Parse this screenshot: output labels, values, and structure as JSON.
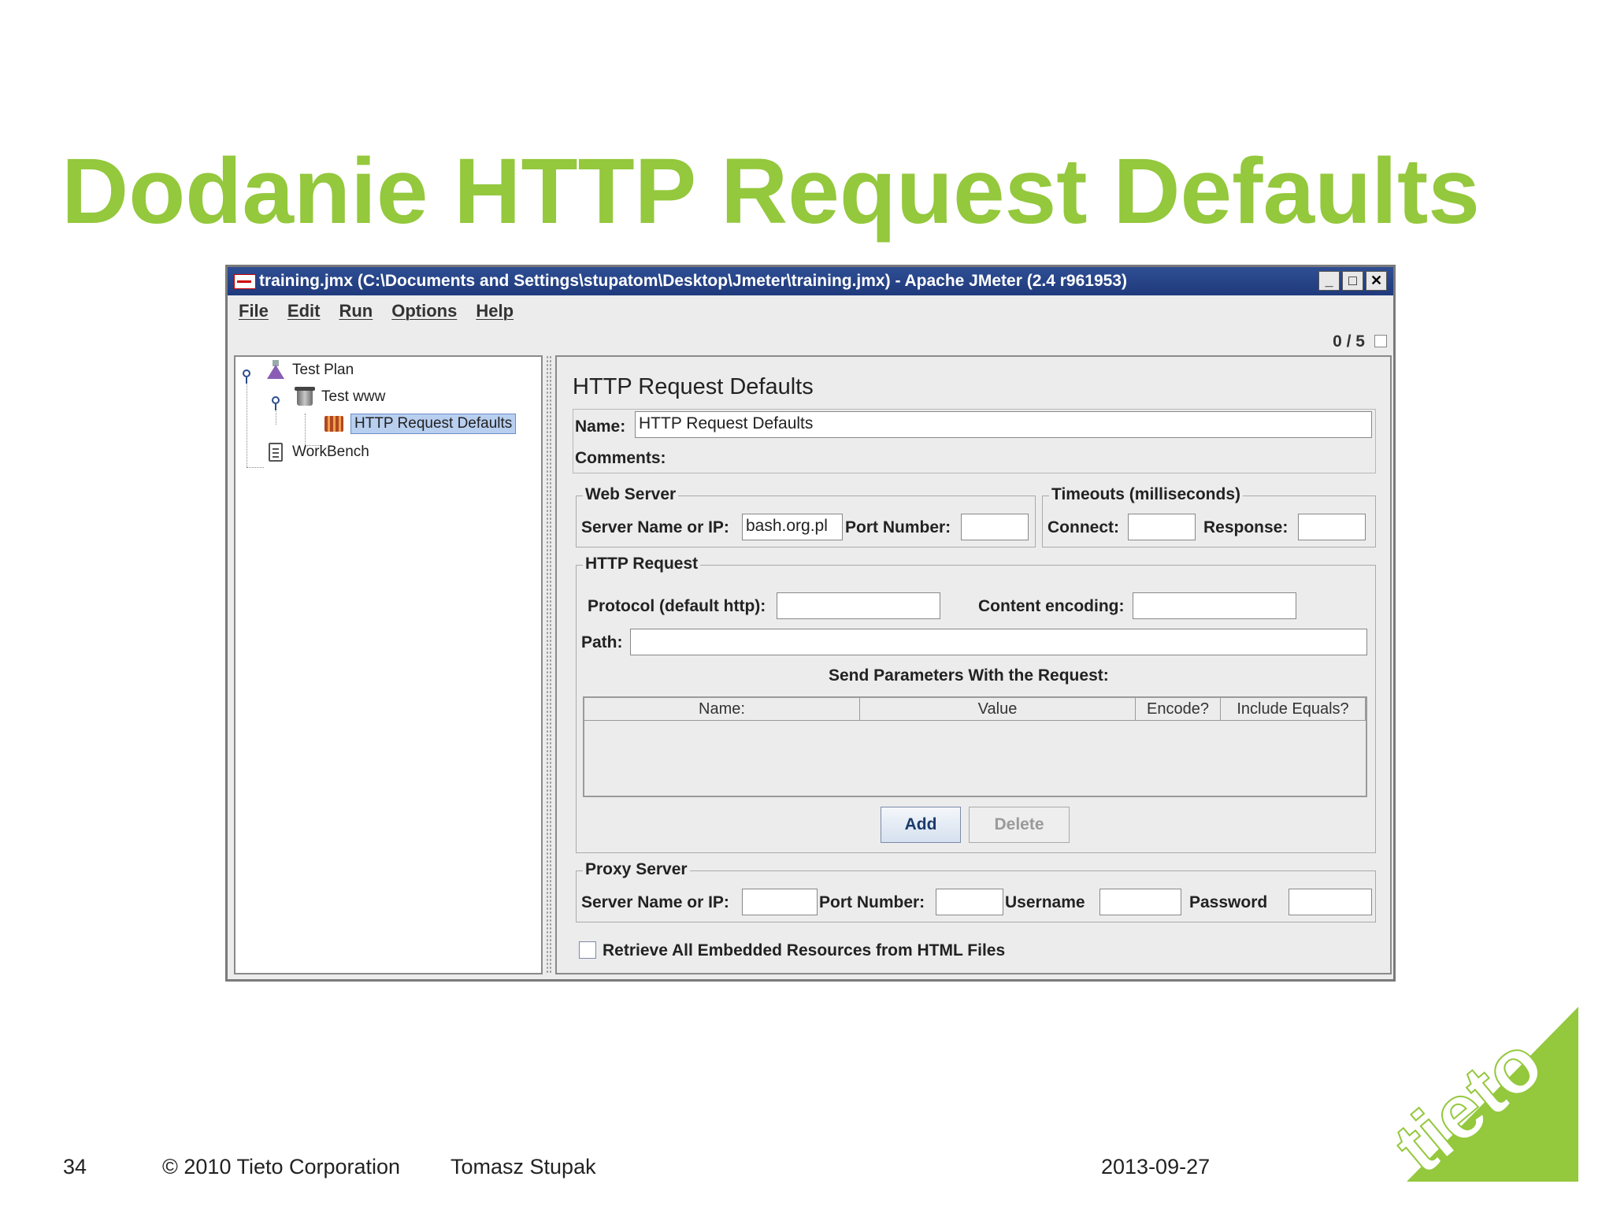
{
  "slide": {
    "title": "Dodanie HTTP Request Defaults"
  },
  "window": {
    "title": "training.jmx (C:\\Documents and Settings\\stupatom\\Desktop\\Jmeter\\training.jmx) - Apache JMeter (2.4 r961953)",
    "controls": {
      "minimize": "_",
      "maximize": "□",
      "close": "✕"
    },
    "menu": [
      "File",
      "Edit",
      "Run",
      "Options",
      "Help"
    ],
    "thread_counter": "0 / 5"
  },
  "tree": {
    "nodes": [
      {
        "label": "Test Plan",
        "icon": "flask-icon"
      },
      {
        "label": "Test www",
        "icon": "thread-group-icon"
      },
      {
        "label": "HTTP Request Defaults",
        "icon": "config-element-icon",
        "selected": true
      },
      {
        "label": "WorkBench",
        "icon": "clipboard-icon"
      }
    ]
  },
  "panel": {
    "title": "HTTP Request Defaults",
    "name_label": "Name:",
    "name_value": "HTTP Request Defaults",
    "comments_label": "Comments:",
    "web_server": {
      "title": "Web Server",
      "server_label": "Server Name or IP:",
      "server_value": "bash.org.pl",
      "port_label": "Port Number:",
      "port_value": ""
    },
    "timeouts": {
      "title": "Timeouts (milliseconds)",
      "connect_label": "Connect:",
      "connect_value": "",
      "response_label": "Response:",
      "response_value": ""
    },
    "http_request": {
      "title": "HTTP Request",
      "protocol_label": "Protocol (default http):",
      "protocol_value": "",
      "encoding_label": "Content encoding:",
      "encoding_value": "",
      "path_label": "Path:",
      "path_value": "",
      "params_heading": "Send Parameters With the Request:",
      "columns": [
        "Name:",
        "Value",
        "Encode?",
        "Include Equals?"
      ],
      "add_label": "Add",
      "delete_label": "Delete"
    },
    "proxy": {
      "title": "Proxy Server",
      "server_label": "Server Name or IP:",
      "port_label": "Port Number:",
      "username_label": "Username",
      "password_label": "Password"
    },
    "embedded_label": "Retrieve All Embedded Resources from HTML Files",
    "embedded_checked": false
  },
  "footer": {
    "page_number": "34",
    "copyright": "© 2010 Tieto Corporation",
    "author": "Tomasz Stupak",
    "date": "2013-09-27"
  },
  "logo": {
    "text": "tieto",
    "color": "#94c83d"
  },
  "colors": {
    "accent": "#94c83d",
    "titlebar": "#2a4a8e"
  }
}
